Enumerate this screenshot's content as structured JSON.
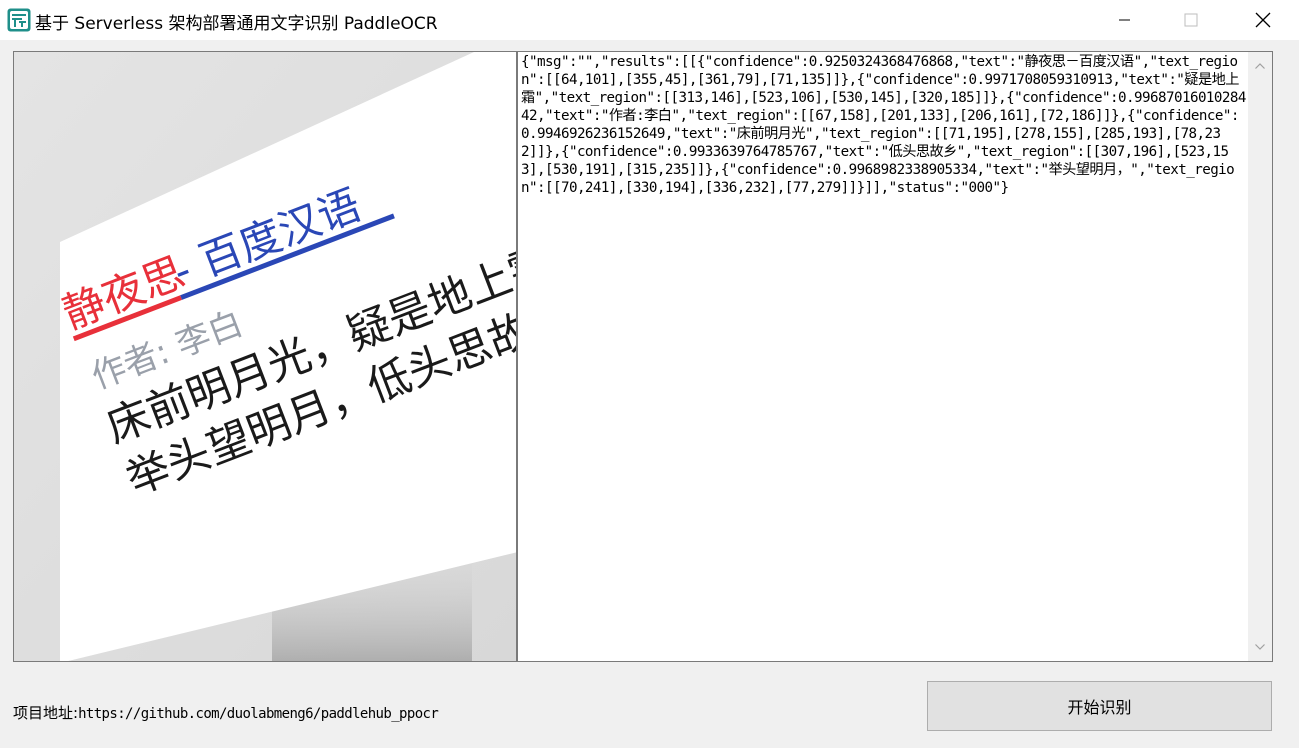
{
  "window": {
    "title": "基于 Serverless 架构部署通用文字识别 PaddleOCR",
    "icon": "app-logo-icon",
    "controls": [
      "minimize-icon",
      "maximize-icon",
      "close-icon"
    ]
  },
  "image_panel": {
    "card": {
      "title_red": "静夜思",
      "title_blue": " - 百度汉语",
      "author": "作者: 李白",
      "line1": "床前明月光，疑是地上霜。",
      "line2": "举头望明月，低头思故乡。"
    },
    "colors": {
      "title_red": "#e8303a",
      "title_blue": "#2a47b6",
      "author": "#9aa0aa",
      "text": "#1a1a1a"
    }
  },
  "result": {
    "text": "{\"msg\":\"\",\"results\":[[{\"confidence\":0.9250324368476868,\"text\":\"静夜思－百度汉语\",\"text_region\":[[64,101],[355,45],[361,79],[71,135]]},{\"confidence\":0.9971708059310913,\"text\":\"疑是地上霜\",\"text_region\":[[313,146],[523,106],[530,145],[320,185]]},{\"confidence\":0.9968701601028442,\"text\":\"作者:李白\",\"text_region\":[[67,158],[201,133],[206,161],[72,186]]},{\"confidence\":0.9946926236152649,\"text\":\"床前明月光\",\"text_region\":[[71,195],[278,155],[285,193],[78,232]]},{\"confidence\":0.9933639764785767,\"text\":\"低头思故乡\",\"text_region\":[[307,196],[523,153],[530,191],[315,235]]},{\"confidence\":0.9968982338905334,\"text\":\"举头望明月，\",\"text_region\":[[70,241],[330,194],[336,232],[77,279]]}]],\"status\":\"000\"}"
  },
  "footer": {
    "label": "项目地址:",
    "url": "https://github.com/duolabmeng6/paddlehub_ppocr"
  },
  "actions": {
    "start_label": "开始识别"
  }
}
